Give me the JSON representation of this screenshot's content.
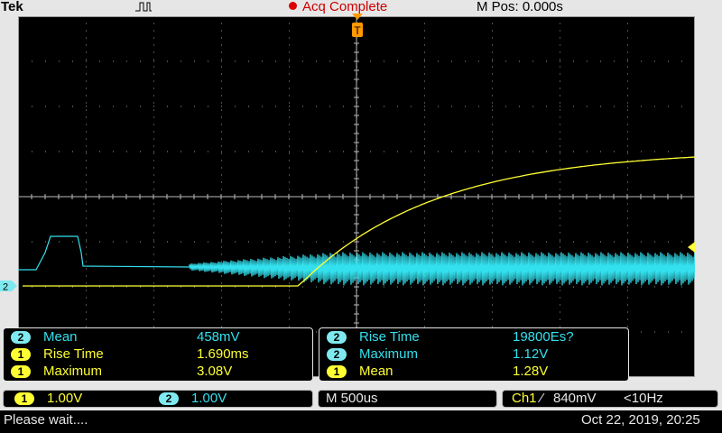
{
  "header": {
    "brand": "Tek",
    "acq_status": "Acq Complete",
    "m_pos": "M Pos: 0.000s"
  },
  "markers": {
    "ch2_ground": "2",
    "trigger": "T"
  },
  "measurements_left": [
    {
      "channel": "2",
      "label": "Mean",
      "value": "458mV"
    },
    {
      "channel": "1",
      "label": "Rise Time",
      "value": "1.690ms"
    },
    {
      "channel": "1",
      "label": "Maximum",
      "value": "3.08V"
    }
  ],
  "measurements_right": [
    {
      "channel": "2",
      "label": "Rise Time",
      "value": "19800Es?"
    },
    {
      "channel": "2",
      "label": "Maximum",
      "value": "1.12V"
    },
    {
      "channel": "1",
      "label": "Mean",
      "value": "1.28V"
    }
  ],
  "scales": {
    "ch1": {
      "channel": "1",
      "value": "1.00V"
    },
    "ch2": {
      "channel": "2",
      "value": "1.00V"
    },
    "timebase": "M 500us",
    "trigger_source": "Ch1",
    "trigger_slope": "⁄",
    "trigger_level": "840mV",
    "trigger_freq": "<10Hz"
  },
  "footer": {
    "message": "Please wait....",
    "datetime": "Oct 22, 2019, 20:25"
  },
  "colors": {
    "ch1": "#ffff33",
    "ch2": "#33e0ee",
    "grid": "#9a9a9a",
    "trigger": "#ff9900"
  }
}
